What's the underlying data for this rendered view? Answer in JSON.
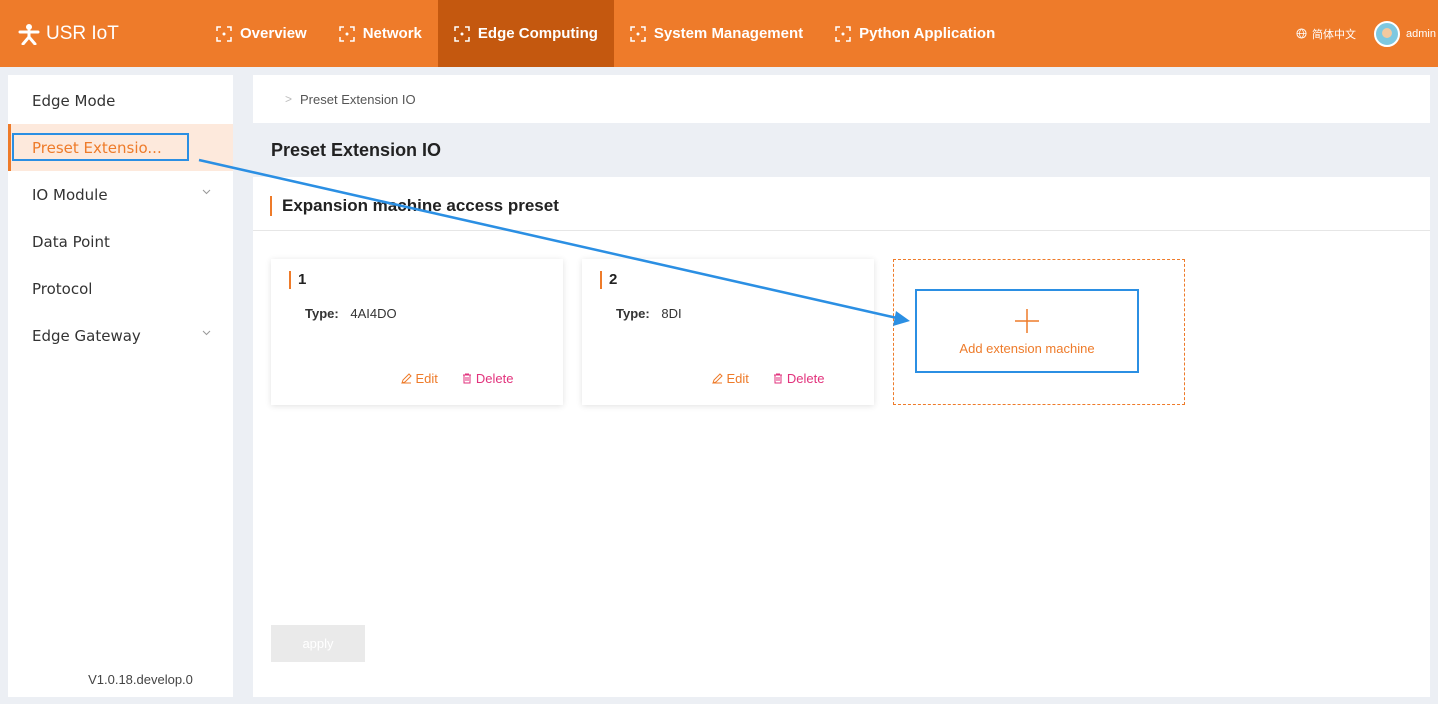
{
  "header": {
    "brand": "USR IoT",
    "nav": [
      {
        "label": "Overview"
      },
      {
        "label": "Network"
      },
      {
        "label": "Edge Computing"
      },
      {
        "label": "System Management"
      },
      {
        "label": "Python Application"
      }
    ],
    "language": "简体中文",
    "username": "admin",
    "accent_color": "#ee7b2a",
    "active_nav_color": "#c4580f"
  },
  "sidebar": {
    "items": [
      {
        "label": "Edge Mode"
      },
      {
        "label": "Preset Extensio..."
      },
      {
        "label": "IO Module"
      },
      {
        "label": "Data Point"
      },
      {
        "label": "Protocol"
      },
      {
        "label": "Edge Gateway"
      }
    ],
    "version": "V1.0.18.develop.0"
  },
  "breadcrumb": "Preset Extension IO",
  "page_title": "Preset Extension IO",
  "section_title": "Expansion machine access preset",
  "cards": [
    {
      "number": "1",
      "type_label": "Type:",
      "type_value": "4AI4DO",
      "edit": "Edit",
      "delete": "Delete"
    },
    {
      "number": "2",
      "type_label": "Type:",
      "type_value": "8DI",
      "edit": "Edit",
      "delete": "Delete"
    }
  ],
  "add_label": "Add extension machine",
  "apply_label": "apply",
  "highlight_color": "#2b8fe3"
}
